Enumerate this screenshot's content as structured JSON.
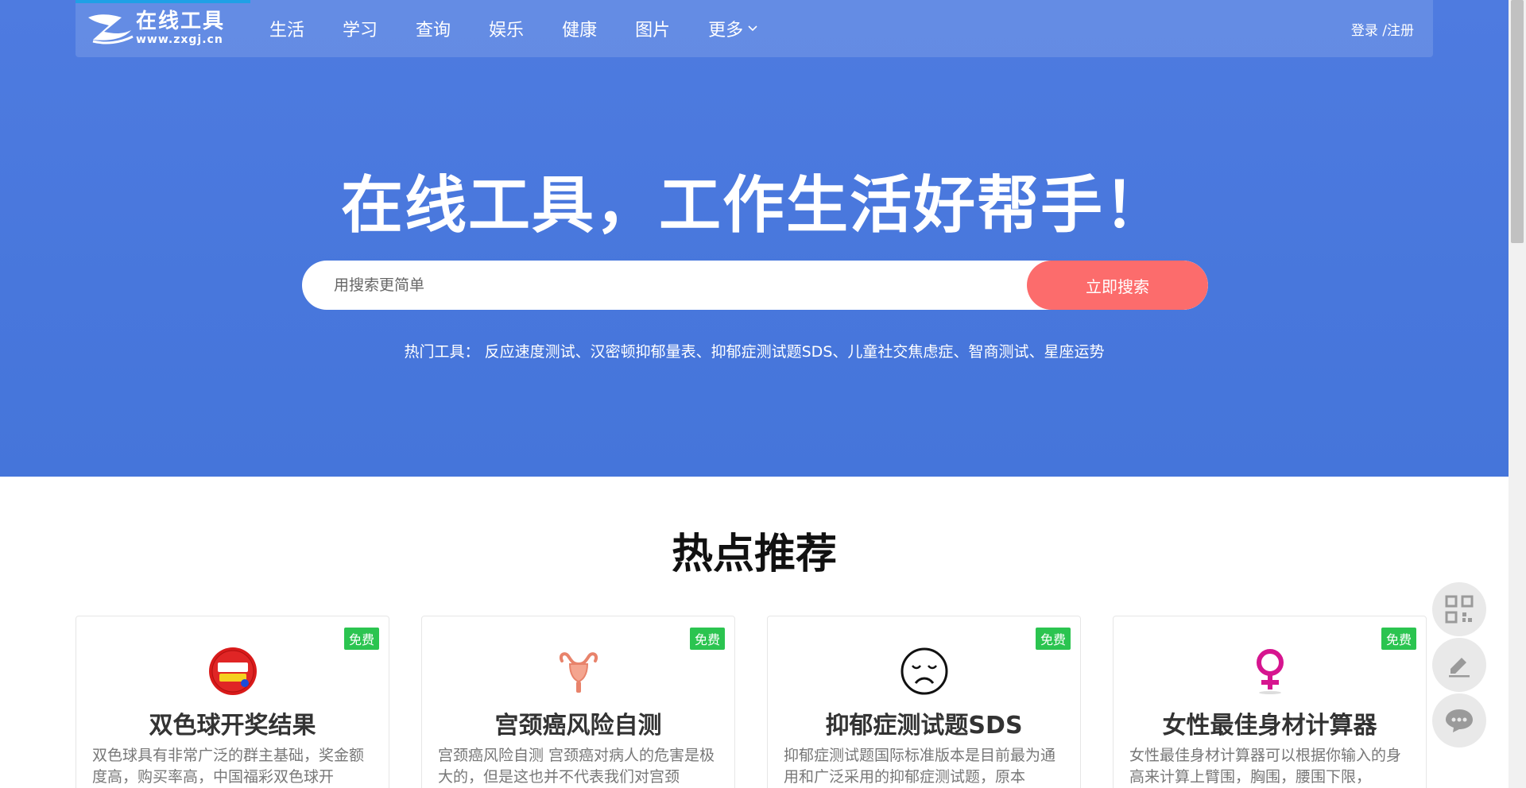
{
  "nav": {
    "logo_title": "在线工具",
    "logo_url": "www.zxgj.cn",
    "items": [
      "生活",
      "学习",
      "查询",
      "娱乐",
      "健康",
      "图片",
      "更多"
    ],
    "login": "登录 /注册"
  },
  "hero": {
    "title": "在线工具，工作生活好帮手！",
    "search_placeholder": "用搜索更简单",
    "search_button": "立即搜索",
    "hot_label": "热门工具：",
    "hot_items": [
      "反应速度测试",
      "汉密顿抑郁量表",
      "抑郁症测试题SDS",
      "儿童社交焦虑症",
      "智商测试",
      "星座运势"
    ]
  },
  "recommend": {
    "title": "热点推荐",
    "cards": [
      {
        "badge": "免费",
        "title": "双色球开奖结果",
        "desc": "双色球具有非常广泛的群主基础，奖金额度高，购买率高，中国福彩双色球开",
        "icon": "lottery-ball-icon"
      },
      {
        "badge": "免费",
        "title": "宫颈癌风险自测",
        "desc": "宫颈癌风险自测 宫颈癌对病人的危害是极大的，但是这也并不代表我们对宫颈",
        "icon": "uterus-icon"
      },
      {
        "badge": "免费",
        "title": "抑郁症测试题SDS",
        "desc": "抑郁症测试题国际标准版本是目前最为通用和广泛采用的抑郁症测试题，原本",
        "icon": "sad-face-icon"
      },
      {
        "badge": "免费",
        "title": "女性最佳身材计算器",
        "desc": "女性最佳身材计算器可以根据你输入的身高来计算上臂围，胸围，腰围下限，",
        "icon": "female-symbol-icon"
      }
    ]
  },
  "colors": {
    "hero_bg": "#4a78dc",
    "search_button": "#fc6c6c",
    "badge": "#2bc450"
  }
}
